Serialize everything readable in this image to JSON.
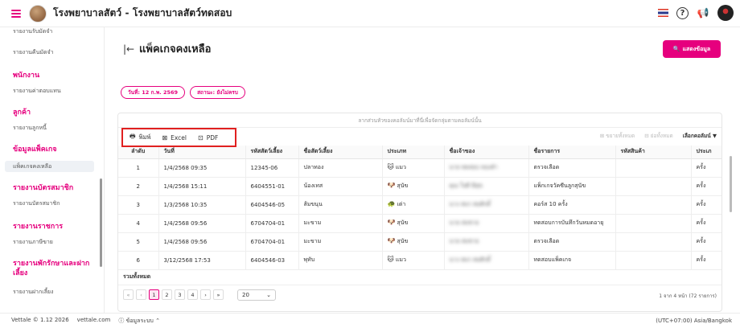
{
  "app": {
    "title": "โรงพยาบาลสัตว์ - โรงพยาบาลสัตว์ทดสอบ"
  },
  "sidebar": {
    "items": [
      {
        "type": "item",
        "label": "รายงานรับมัดจำ"
      },
      {
        "type": "item",
        "label": "รายงานคืนมัดจำ"
      },
      {
        "type": "head",
        "label": "พนักงาน"
      },
      {
        "type": "item",
        "label": "รายงานค่าตอบแทน"
      },
      {
        "type": "head",
        "label": "ลูกค้า"
      },
      {
        "type": "item",
        "label": "รายงานลูกหนี้"
      },
      {
        "type": "head",
        "label": "ข้อมูลแพ็คเกจ"
      },
      {
        "type": "item",
        "label": "แพ็คเกจคงเหลือ",
        "active": true
      },
      {
        "type": "head",
        "label": "รายงานบัตรสมาชิก"
      },
      {
        "type": "item",
        "label": "รายงานบัตรสมาชิก"
      },
      {
        "type": "head",
        "label": "รายงานราชการ"
      },
      {
        "type": "item",
        "label": "รายงานภาษีขาย"
      },
      {
        "type": "head",
        "label": "รายงานพักรักษาและฝากเลี้ยง"
      },
      {
        "type": "item",
        "label": "รายงานฝากเลี้ยง"
      }
    ]
  },
  "page": {
    "title": "แพ็คเกจคงเหลือ",
    "show_button": "แสดงข้อมูล",
    "filters": [
      "วันที่: 12 ก.พ. 2569",
      "สถานะ: ยังไม่ครบ"
    ]
  },
  "table": {
    "drag_hint": "ลากส่วนหัวของคอลัมน์มาที่นี่เพื่อจัดกลุ่มตามคอลัมน์นั้น",
    "print": "พิมพ์",
    "excel": "Excel",
    "pdf": "PDF",
    "expand_all": "ขยายทั้งหมด",
    "collapse_all": "ย่อทั้งหมด",
    "choose_columns": "เลือกคอลัมน์",
    "columns": [
      "ลำดับ",
      "วันที่",
      "รหัสสัตว์เลี้ยง",
      "ชื่อสัตว์เลี้ยง",
      "ประเภท",
      "ชื่อเจ้าของ",
      "ชื่อรายการ",
      "รหัสสินค้า",
      "ประเภ"
    ],
    "rows": [
      {
        "no": "1",
        "date": "1/4/2568 09:35",
        "pet_code": "12345-06",
        "pet_name": "ปลาทอง",
        "icon": "🐱",
        "type": "แมว",
        "owner": "นาย ทดสอบ ทองคำ",
        "item": "ตรวจเลือด",
        "code": "",
        "last": "ครั้ง"
      },
      {
        "no": "2",
        "date": "1/4/2568 15:11",
        "pet_code": "6404551-01",
        "pet_name": "น้องเทส",
        "icon": "🐶",
        "type": "สุนัข",
        "owner": "คุณ ใจดี มีสุข",
        "item": "แพ็กเกจวัคซีนลูกสุนัข",
        "code": "",
        "last": "ครั้ง"
      },
      {
        "no": "3",
        "date": "1/3/2568 10:35",
        "pet_code": "6404546-05",
        "pet_name": "ส้มขนุน",
        "icon": "🐢",
        "type": "เต่า",
        "owner": "นาง สมร สมศักดิ์",
        "item": "คอร์ส 10 ครั้ง",
        "code": "",
        "last": "ครั้ง"
      },
      {
        "no": "4",
        "date": "1/4/2568 09:56",
        "pet_code": "6704704-01",
        "pet_name": "มะขาม",
        "icon": "🐶",
        "type": "สุนัข",
        "owner": "นาย สมชาย",
        "item": "ทดสอบการบันทึกวันหมดอายุ",
        "code": "",
        "last": "ครั้ง"
      },
      {
        "no": "5",
        "date": "1/4/2568 09:56",
        "pet_code": "6704704-01",
        "pet_name": "มะขาม",
        "icon": "🐶",
        "type": "สุนัข",
        "owner": "นาย สมชาย",
        "item": "ตรวจเลือด",
        "code": "",
        "last": "ครั้ง"
      },
      {
        "no": "6",
        "date": "3/12/2568 17:53",
        "pet_code": "6404546-03",
        "pet_name": "พุทับ",
        "icon": "🐱",
        "type": "แมว",
        "owner": "นาง สมร สมศักดิ์",
        "item": "ทดสอบแพ็คเกจ",
        "code": "",
        "last": "ครั้ง"
      }
    ],
    "total_label": "รวมทั้งหมด"
  },
  "pager": {
    "pages": [
      "1",
      "2",
      "3",
      "4"
    ],
    "current": "1",
    "page_size": "20",
    "info": "1 จาก 4 หน้า (72 รายการ)"
  },
  "footer": {
    "version": "Vettale © 1.12 2026",
    "site": "vettale.com",
    "system": "ข้อมูลระบบ",
    "timezone": "(UTC+07:00) Asia/Bangkok"
  },
  "colors": {
    "accent": "#e6007e",
    "highlight": "#e02020"
  }
}
